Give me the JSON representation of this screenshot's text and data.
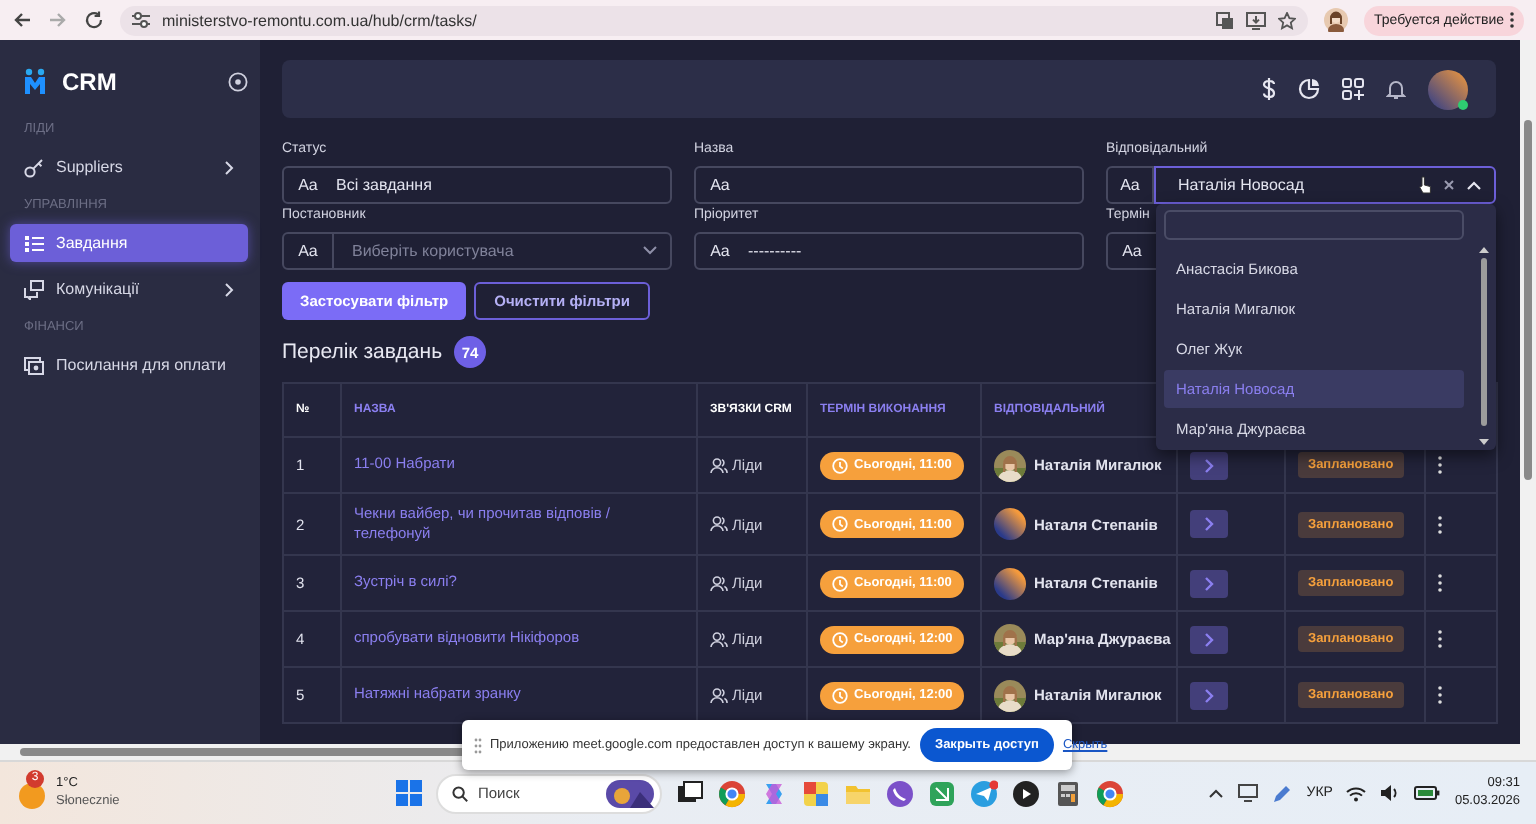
{
  "browser": {
    "url": "ministerstvo-remontu.com.ua/hub/crm/tasks/",
    "action_button": "Требуется действие"
  },
  "sidebar": {
    "logo": "CRM",
    "sections": [
      {
        "title": "ЛІДИ",
        "items": [
          {
            "label": "Suppliers",
            "submenu": true,
            "selected": false
          }
        ]
      },
      {
        "title": "УПРАВЛІННЯ",
        "items": [
          {
            "label": "Завдання",
            "submenu": false,
            "selected": true
          },
          {
            "label": "Комунікації",
            "submenu": true,
            "selected": false
          }
        ]
      },
      {
        "title": "ФІНАНСИ",
        "items": [
          {
            "label": "Посилання для оплати",
            "submenu": false,
            "selected": false
          }
        ]
      }
    ]
  },
  "filters": [
    {
      "label": "Статус",
      "kind": "text",
      "prefix": "Aa",
      "value": "Всі завдання"
    },
    {
      "label": "Назва",
      "kind": "text",
      "prefix": "Aa"
    },
    {
      "label": "Відповідальний",
      "kind": "open-select",
      "prefix": "Aa",
      "value": "Наталія Новосад"
    },
    {
      "label": "Постановник",
      "kind": "select",
      "prefix": "Aa",
      "placeholder": "Виберіть користувача"
    },
    {
      "label": "Пріоритет",
      "kind": "text",
      "prefix": "Aa",
      "value": "----------"
    },
    {
      "label": "Термін",
      "kind": "text",
      "prefix": "Aa"
    }
  ],
  "buttons": [
    {
      "label": "Застосувати фільтр",
      "kind": "primary"
    },
    {
      "label": "Очистити фільтри",
      "kind": "outline"
    }
  ],
  "list_title": "Перелік завдань",
  "count": "74",
  "table": {
    "columns": [
      {
        "label": "№",
        "sortable": false
      },
      {
        "label": "НАЗВА",
        "sortable": true
      },
      {
        "label": "ЗВ'ЯЗКИ CRM",
        "sortable": false
      },
      {
        "label": "ТЕРМІН ВИКОНАННЯ",
        "sortable": true
      },
      {
        "label": "ВІДПОВІДАЛЬНИЙ",
        "sortable": true
      }
    ],
    "rows": [
      {
        "number": "1",
        "name": "11-00 Набрати",
        "relation": "Ліди",
        "due": "Сьогодні, 11:00",
        "assignee": "Наталія Мигалюк",
        "status": "Заплановано"
      },
      {
        "number": "2",
        "name": "Чекни вайбер, чи прочитав відповів / телефонуй",
        "relation": "Ліди",
        "due": "Сьогодні, 11:00",
        "assignee": "Наталя Степанів",
        "kind": "gradient",
        "status": "Заплановано"
      },
      {
        "number": "3",
        "name": "Зустріч в силі?",
        "relation": "Ліди",
        "due": "Сьогодні, 11:00",
        "assignee": "Наталя Степанів",
        "kind": "gradient",
        "status": "Заплановано"
      },
      {
        "number": "4",
        "name": "спробувати відновити Нікіфоров",
        "relation": "Ліди",
        "due": "Сьогодні, 12:00",
        "assignee": "Мар'яна Джураєва",
        "status": "Заплановано"
      },
      {
        "number": "5",
        "name": "Натяжні набрати зранку",
        "relation": "Ліди",
        "due": "Сьогодні, 12:00",
        "assignee": "Наталія Мигалюк",
        "status": "Заплановано"
      }
    ]
  },
  "dropdown": {
    "options": [
      {
        "label": "Анастасія Бикова",
        "selected": false
      },
      {
        "label": "Наталія Мигалюк",
        "selected": false
      },
      {
        "label": "Олег Жук",
        "selected": false
      },
      {
        "label": "Наталія Новосад",
        "selected": true
      },
      {
        "label": "Мар'яна Джураєва",
        "selected": false
      }
    ]
  },
  "share_banner": {
    "text": "Приложению meet.google.com предоставлен доступ к вашему экрану.",
    "stop_button": "Закрыть доступ",
    "hide_link": "Скрыть"
  },
  "taskbar": {
    "weather_badge": "3",
    "temperature": "1°C",
    "condition": "Słonecznie",
    "search_placeholder": "Поиск",
    "language": "УКР",
    "time": "09:31",
    "date": "05.03.2026"
  }
}
